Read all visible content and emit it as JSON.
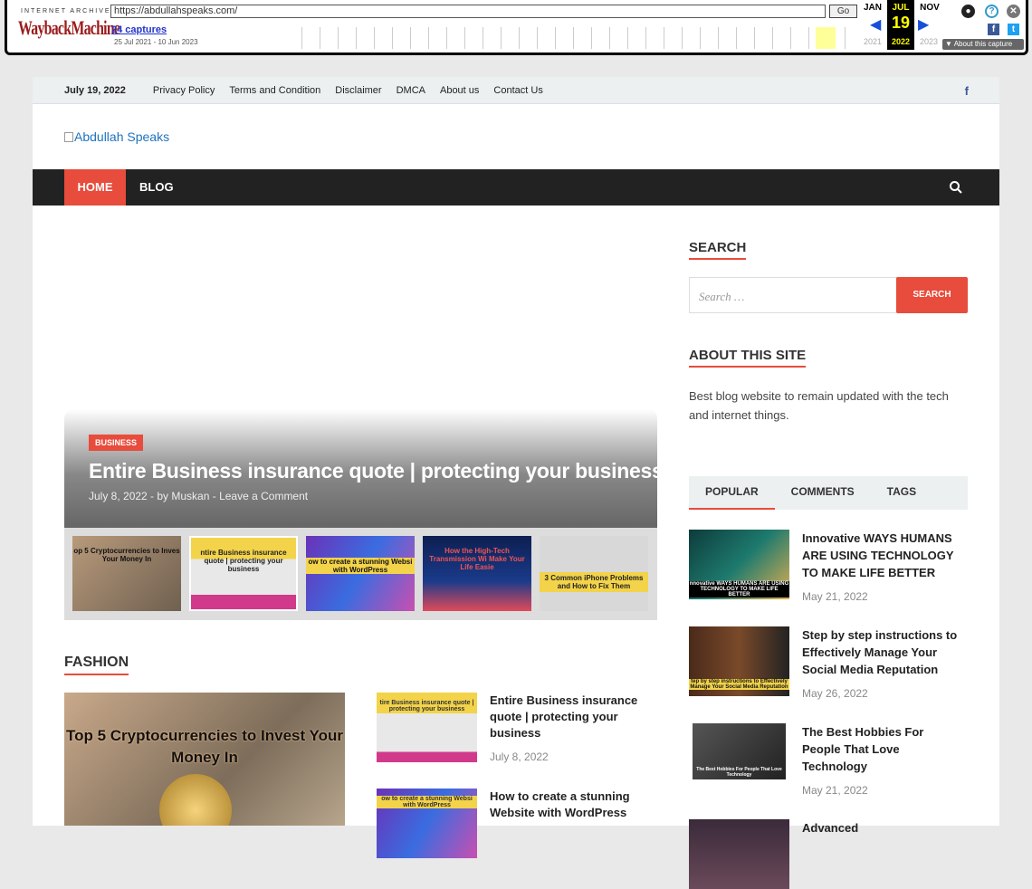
{
  "wayback": {
    "brand_small": "INTERNET ARCHIVE",
    "brand_logo": "WaybackMachine",
    "url": "https://abdullahspeaks.com/",
    "go": "Go",
    "captures": "24 captures",
    "range": "25 Jul 2021 - 10 Jun 2023",
    "prev_month": "JAN",
    "cur_month": "JUL",
    "next_month": "NOV",
    "cur_day": "19",
    "prev_year": "2021",
    "cur_year": "2022",
    "next_year": "2023",
    "about_capture": "▼ About this capture"
  },
  "topbar": {
    "date": "July 19, 2022",
    "links": [
      "Privacy Policy",
      "Terms and Condition",
      "Disclaimer",
      "DMCA",
      "About us",
      "Contact Us"
    ],
    "facebook": "f"
  },
  "header": {
    "logo_alt": "Abdullah Speaks"
  },
  "nav": {
    "home": "HOME",
    "blog": "BLOG"
  },
  "hero": {
    "category": "BUSINESS",
    "title": "Entire Business insurance quote | protecting your business",
    "meta": "July 8, 2022  -  by Muskan  -  Leave a Comment"
  },
  "thumbs": [
    {
      "text": "op 5 Cryptocurrencies to Inves Your Money In"
    },
    {
      "text": "ntire Business insurance quote | protecting your business"
    },
    {
      "text": "ow to create a stunning Websi with WordPress"
    },
    {
      "text": "How the High-Tech Transmission Wi Make Your Life Easie"
    },
    {
      "text": "3 Common iPhone Problems and How to Fix Them"
    }
  ],
  "fashion": {
    "title": "FASHION",
    "big_caption": "Top 5 Cryptocurrencies to Invest Your Money In",
    "items": [
      {
        "title": "Entire Business insurance quote | protecting your business",
        "date": "July 8, 2022",
        "img_text": "tire Business insurance quote | protecting your business"
      },
      {
        "title": "How to create a stunning Website with WordPress",
        "date": "",
        "img_text": "ow to create a stunning Websi with WordPress"
      }
    ]
  },
  "sidebar": {
    "search_title": "SEARCH",
    "search_placeholder": "Search …",
    "search_button": "SEARCH",
    "about_title": "ABOUT THIS SITE",
    "about_text": "Best blog website to remain updated with the tech and internet things.",
    "tabs": [
      "POPULAR",
      "COMMENTS",
      "TAGS"
    ],
    "popular": [
      {
        "title": "Innovative WAYS HUMANS ARE USING TECHNOLOGY TO MAKE LIFE BETTER",
        "date": "May 21, 2022",
        "img_text": "nnovative WAYS HUMANS ARE USING TECHNOLOGY TO MAKE LIFE BETTER"
      },
      {
        "title": "Step by step instructions to Effectively Manage Your Social Media Reputation",
        "date": "May 26, 2022",
        "img_text": "tep by step instructions to Effectively Manage Your Social Media Reputation"
      },
      {
        "title": "The Best Hobbies For People That Love Technology",
        "date": "May 21, 2022",
        "img_text": "The Best Hobbies For People That Love Technology"
      },
      {
        "title": "Advanced",
        "date": "",
        "img_text": ""
      }
    ]
  }
}
